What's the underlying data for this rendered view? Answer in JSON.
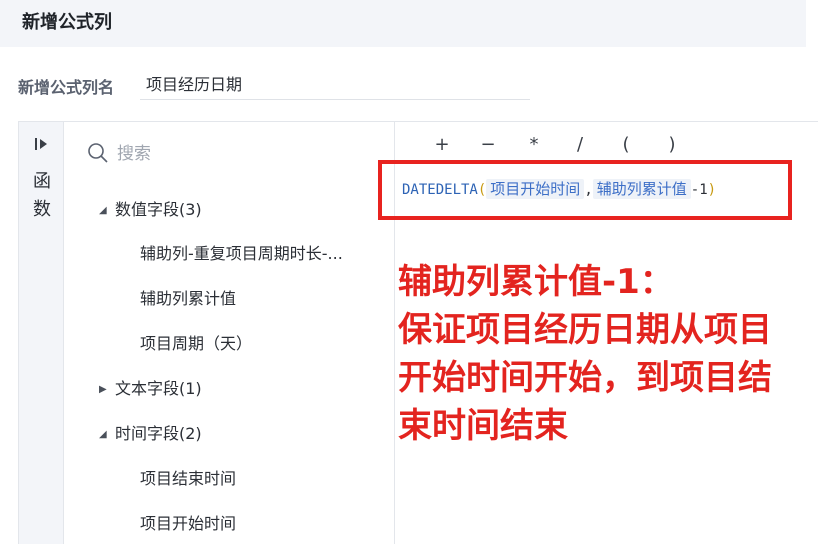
{
  "header": {
    "title": "新增公式列"
  },
  "name_field": {
    "label": "新增公式列名",
    "value": "项目经历日期"
  },
  "side_rail": {
    "label": "函数"
  },
  "search": {
    "placeholder": "搜索"
  },
  "tree": [
    {
      "label": "数值字段(3)",
      "expanded": true,
      "children": [
        "辅助列-重复项目周期时长-...",
        "辅助列累计值",
        "项目周期（天）"
      ]
    },
    {
      "label": "文本字段(1)",
      "expanded": false,
      "children": []
    },
    {
      "label": "时间字段(2)",
      "expanded": true,
      "children": [
        "项目结束时间",
        "项目开始时间"
      ]
    }
  ],
  "operators": [
    "+",
    "−",
    "*",
    "/",
    "(",
    ")"
  ],
  "formula": {
    "func": "DATEDELTA",
    "open": "(",
    "arg1": "项目开始时间",
    "sep": ",",
    "arg2": "辅助列累计值",
    "tail": "-1",
    "close": ")"
  },
  "annotation": {
    "lines": [
      "辅助列累计值-1：",
      "保证项目经历日期从项目",
      "开始时间开始，到项目结",
      "束时间结束"
    ],
    "color": "#e3241f"
  },
  "colors": {
    "accent_box": "#e8231f",
    "field_chip": "#3d6fc7",
    "function": "#2d63b5"
  }
}
